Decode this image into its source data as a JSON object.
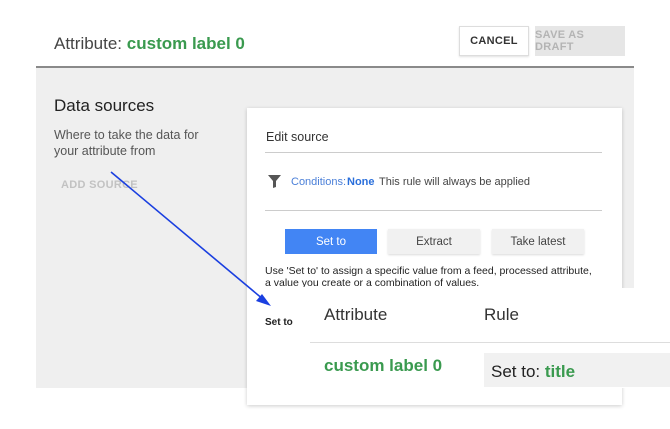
{
  "header": {
    "title_prefix": "Attribute:",
    "title_name": "custom label 0",
    "cancel_label": "CANCEL",
    "save_draft_label": "SAVE AS DRAFT"
  },
  "data_sources": {
    "title": "Data sources",
    "description": "Where to take the data for your attribute from",
    "add_source_label": "ADD SOURCE"
  },
  "edit_source": {
    "title": "Edit source",
    "conditions_label": "Conditions:",
    "conditions_value": "None",
    "conditions_note": "This rule will always be applied",
    "tabs": [
      {
        "label": "Set to"
      },
      {
        "label": "Extract"
      },
      {
        "label": "Take latest"
      }
    ],
    "help_text": "Use 'Set to' to assign a specific value from a feed, processed attribute, a value you create or a combination of values.",
    "set_to_label": "Set to"
  },
  "zoom": {
    "attribute_header": "Attribute",
    "rule_header": "Rule",
    "attribute_value": "custom label 0",
    "rule_prefix": "Set to:",
    "rule_value": "title"
  },
  "colors": {
    "accent_green": "#3a9a4f",
    "primary_blue": "#4285f4",
    "arrow_blue": "#1a3fe0"
  }
}
